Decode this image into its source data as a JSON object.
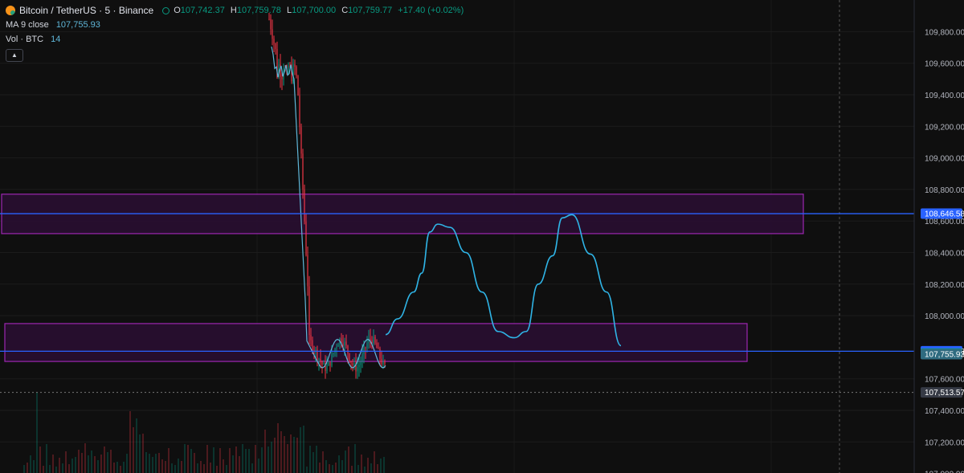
{
  "legend": {
    "symbol": "Bitcoin / TetherUS · 5 · Binance",
    "open_label": "O",
    "open": "107,742.37",
    "high_label": "H",
    "high": "107,759.78",
    "low_label": "L",
    "low": "107,700.00",
    "close_label": "C",
    "close": "107,759.77",
    "change": "+17.40 (+0.02%)",
    "ma_label": "MA 9 close",
    "ma_value": "107,755.93",
    "vol_label": "Vol · BTC",
    "vol_value": "14",
    "collapse_icon": "chevron-up-icon"
  },
  "colors": {
    "background": "#0f0f0f",
    "up": "#089981",
    "down": "#f23645",
    "ma": "#5fb6d8",
    "zone_border": "#9c27b0",
    "zone_fill": "#2a0e33",
    "hline": "#2962ff",
    "drawing": "#2fb4e6",
    "text": "#d1d4dc"
  },
  "chart_data": {
    "type": "candlestick",
    "ylim": [
      107000,
      110000
    ],
    "price_ticks": [
      109800,
      109600,
      109400,
      109200,
      109000,
      108800,
      108600,
      108400,
      108200,
      108000,
      107600,
      107400,
      107200,
      107000
    ],
    "price_tick_labels": [
      "109,800.00",
      "109,600.00",
      "109,400.00",
      "109,200.00",
      "109,000.00",
      "108,800.00",
      "108,600.00",
      "108,400.00",
      "108,200.00",
      "108,000.00",
      "107,600.00",
      "107,400.00",
      "107,200.00",
      "107,000.00"
    ],
    "price_labels": [
      {
        "value": 108646.58,
        "text": "108,646.58",
        "color": "#2962ff"
      },
      {
        "value": 107774.58,
        "text": "107,774.58",
        "color": "#2962ff"
      },
      {
        "value": 107759.77,
        "text": "107,759.77",
        "color": "#089981"
      },
      {
        "value": 107755.93,
        "text": "107,755.93",
        "color": "#2f6b80"
      },
      {
        "value": 107513.57,
        "text": "107,513.57",
        "color": "#363a45"
      }
    ],
    "horizontal_lines": [
      108646.58,
      107774.58
    ],
    "crosshair_price": 107513.57,
    "zones": [
      {
        "top": 108770,
        "bottom": 108520,
        "color": "#9c27b0"
      },
      {
        "top": 107950,
        "bottom": 107710,
        "color": "#9c27b0"
      }
    ],
    "projection_path_prices": [
      107880,
      107980,
      108150,
      108270,
      108530,
      108580,
      108560,
      108400,
      108150,
      107900,
      107860,
      107900,
      108200,
      108380,
      108620,
      108640,
      108390,
      108150,
      107810
    ],
    "candle_extremes": {
      "max_high": 110000,
      "min_low": 107480,
      "start": 109880,
      "end": 107759.77
    }
  }
}
